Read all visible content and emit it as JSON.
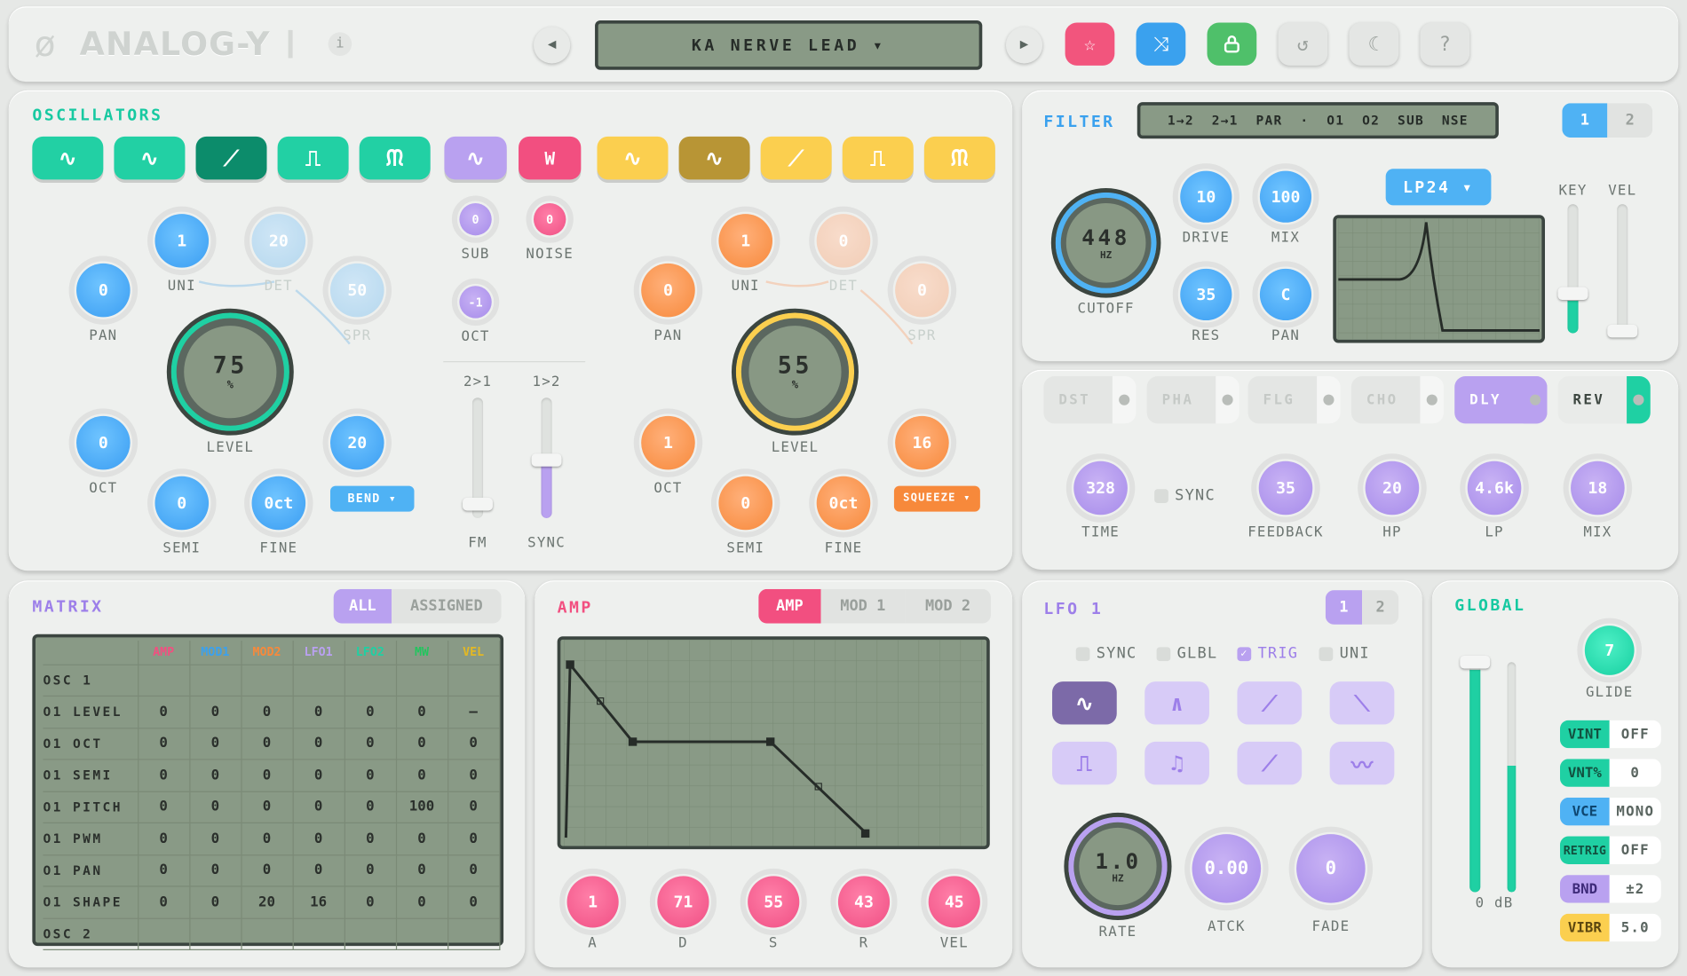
{
  "header": {
    "logo": "ANALOG-Y",
    "info": "i",
    "preset": "KA NERVE LEAD ▾",
    "prev": "◀",
    "next": "▶"
  },
  "osc": {
    "title": "OSCILLATORS",
    "waves": [
      "∿",
      "∿",
      "⟋",
      "⎍",
      "ᙏ",
      "∿",
      "W",
      "∿",
      "∿",
      "⟋",
      "⎍",
      "ᙏ"
    ],
    "o1": {
      "uni": "1",
      "det": "20",
      "pan": "0",
      "spr": "50",
      "level": "75",
      "level_unit": "%",
      "oct": "0",
      "bend_val": "20",
      "semi": "0",
      "fine": "0ct",
      "bend": "BEND ▾"
    },
    "sub": "0",
    "noise": "0",
    "oct_mid": "-1",
    "mid_oct_label": "OCT",
    "sub_label": "SUB",
    "noise_label": "NOISE",
    "fm_from": "2>1",
    "sync_from": "1>2",
    "fm_label": "FM",
    "sync_label": "SYNC",
    "o2": {
      "uni": "1",
      "det": "0",
      "pan": "0",
      "spr": "0",
      "level": "55",
      "level_unit": "%",
      "oct": "1",
      "sq_val": "16",
      "semi": "0",
      "fine": "0ct",
      "squeeze": "SQUEEZE ▾"
    },
    "labels": {
      "uni": "UNI",
      "det": "DET",
      "pan": "PAN",
      "spr": "SPR",
      "level": "LEVEL",
      "oct": "OCT",
      "semi": "SEMI",
      "fine": "FINE"
    }
  },
  "filter": {
    "title": "FILTER",
    "routing": "1→2  2→1  PAR  ·  O1  O2  SUB  NSE",
    "tab1": "1",
    "tab2": "2",
    "cutoff": "448",
    "cutoff_unit": "HZ",
    "cutoff_label": "CUTOFF",
    "drive": "10",
    "drive_label": "DRIVE",
    "mix": "100",
    "mix_label": "MIX",
    "res": "35",
    "res_label": "RES",
    "pan": "C",
    "pan_label": "PAN",
    "type": "LP24 ▾",
    "key": "KEY",
    "vel": "VEL"
  },
  "fx": {
    "tabs": [
      "DST",
      "PHA",
      "FLG",
      "CHO",
      "DLY",
      "REV"
    ],
    "time": "328",
    "time_label": "TIME",
    "sync": "SYNC",
    "feedback": "35",
    "feedback_label": "FEEDBACK",
    "hp": "20",
    "hp_label": "HP",
    "lp": "4.6k",
    "lp_label": "LP",
    "mix": "18",
    "mix_label": "MIX"
  },
  "matrix": {
    "title": "MATRIX",
    "all": "ALL",
    "assigned": "ASSIGNED",
    "cols": [
      "AMP",
      "MOD1",
      "MOD2",
      "LFO1",
      "LFO2",
      "MW",
      "VEL"
    ],
    "rows": [
      [
        "OSC 1",
        "",
        "",
        "",
        "",
        "",
        "",
        ""
      ],
      [
        "O1 LEVEL",
        "0",
        "0",
        "0",
        "0",
        "0",
        "0",
        "—"
      ],
      [
        "O1 OCT",
        "0",
        "0",
        "0",
        "0",
        "0",
        "0",
        "0"
      ],
      [
        "O1 SEMI",
        "0",
        "0",
        "0",
        "0",
        "0",
        "0",
        "0"
      ],
      [
        "O1 PITCH",
        "0",
        "0",
        "0",
        "0",
        "0",
        "100",
        "0"
      ],
      [
        "O1 PWM",
        "0",
        "0",
        "0",
        "0",
        "0",
        "0",
        "0"
      ],
      [
        "O1 PAN",
        "0",
        "0",
        "0",
        "0",
        "0",
        "0",
        "0"
      ],
      [
        "O1 SHAPE",
        "0",
        "0",
        "20",
        "16",
        "0",
        "0",
        "0"
      ],
      [
        "OSC 2",
        "",
        "",
        "",
        "",
        "",
        "",
        ""
      ]
    ]
  },
  "amp": {
    "title": "AMP",
    "tabs": [
      "AMP",
      "MOD 1",
      "MOD 2"
    ],
    "a": "1",
    "d": "71",
    "s": "55",
    "r": "43",
    "vel": "45",
    "la": "A",
    "ld": "D",
    "ls": "S",
    "lr": "R",
    "lvel": "VEL"
  },
  "lfo": {
    "title": "LFO 1",
    "tab1": "1",
    "tab2": "2",
    "sync": "SYNC",
    "glbl": "GLBL",
    "trig": "TRIG",
    "uni": "UNI",
    "rate": "1.0",
    "rate_unit": "HZ",
    "rate_label": "RATE",
    "atck": "0.00",
    "atck_label": "ATCK",
    "fade": "0",
    "fade_label": "FADE",
    "shapes": [
      "∿",
      "∧",
      "⟋",
      "⟍",
      "⎍",
      "♫",
      "⟋",
      "〰"
    ]
  },
  "global": {
    "title": "GLOBAL",
    "glide": "7",
    "glide_label": "GLIDE",
    "db": "0 dB",
    "tags": [
      {
        "k": "VINT",
        "v": "OFF"
      },
      {
        "k": "VNT%",
        "v": "0"
      },
      {
        "k": "VCE",
        "v": "MONO"
      },
      {
        "k": "RETRIG",
        "v": "OFF"
      },
      {
        "k": "BND",
        "v": "±2"
      },
      {
        "k": "VIBR",
        "v": "5.0"
      }
    ]
  }
}
